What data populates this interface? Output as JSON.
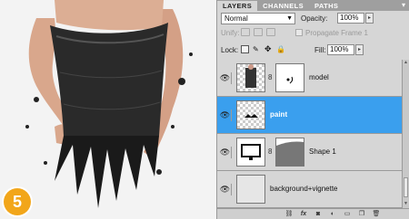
{
  "step_badge": "5",
  "tabs": [
    {
      "label": "LAYERS",
      "active": true
    },
    {
      "label": "CHANNELS",
      "active": false
    },
    {
      "label": "PATHS",
      "active": false
    }
  ],
  "blend_mode": "Normal",
  "opacity": {
    "label": "Opacity:",
    "value": "100%"
  },
  "unify_label": "Unify:",
  "propagate_label": "Propagate Frame 1",
  "lock_label": "Lock:",
  "fill": {
    "label": "Fill:",
    "value": "100%"
  },
  "layers": [
    {
      "name": "model",
      "selected": false
    },
    {
      "name": "paint",
      "selected": true
    },
    {
      "name": "Shape 1",
      "selected": false
    },
    {
      "name": "background+vignette",
      "selected": false
    }
  ],
  "bottom_icons": [
    "link-icon",
    "fx-icon",
    "mask-icon",
    "adjustment-icon",
    "folder-icon",
    "new-layer-icon",
    "trash-icon"
  ],
  "colors": {
    "selection": "#3a9fee",
    "badge": "#f2a61a"
  }
}
